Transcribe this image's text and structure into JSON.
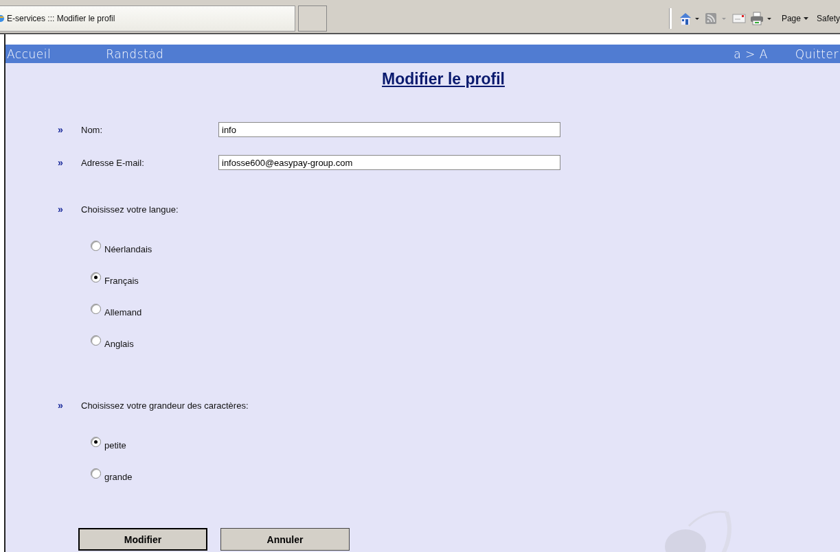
{
  "browser": {
    "tab_title": "E-services ::: Modifier le profil",
    "toolbar": [
      {
        "kind": "home"
      },
      {
        "kind": "feed"
      },
      {
        "kind": "mail"
      },
      {
        "kind": "print"
      },
      {
        "kind": "text",
        "label": "Page"
      },
      {
        "kind": "text",
        "label": "Safety"
      }
    ]
  },
  "nav": {
    "left": [
      "Accueil",
      "Randstad"
    ],
    "right": [
      "a > A",
      "Quitter"
    ]
  },
  "page_title": "Modifier le profil",
  "bullet": "»",
  "fields": [
    {
      "label": "Nom:",
      "value": "info"
    },
    {
      "label": "Adresse E-mail:",
      "value": "infosse600@easypay-group.com"
    }
  ],
  "groups": [
    {
      "label": "Choisissez votre langue:",
      "options": [
        {
          "label": "Néerlandais",
          "selected": false
        },
        {
          "label": "Français",
          "selected": true
        },
        {
          "label": "Allemand",
          "selected": false
        },
        {
          "label": "Anglais",
          "selected": false
        }
      ]
    },
    {
      "label": "Choisissez votre grandeur des caractères:",
      "options": [
        {
          "label": "petite",
          "selected": true
        },
        {
          "label": "grande",
          "selected": false
        }
      ]
    }
  ],
  "buttons": [
    {
      "label": "Modifier",
      "default": true
    },
    {
      "label": "Annuler",
      "default": false
    }
  ]
}
